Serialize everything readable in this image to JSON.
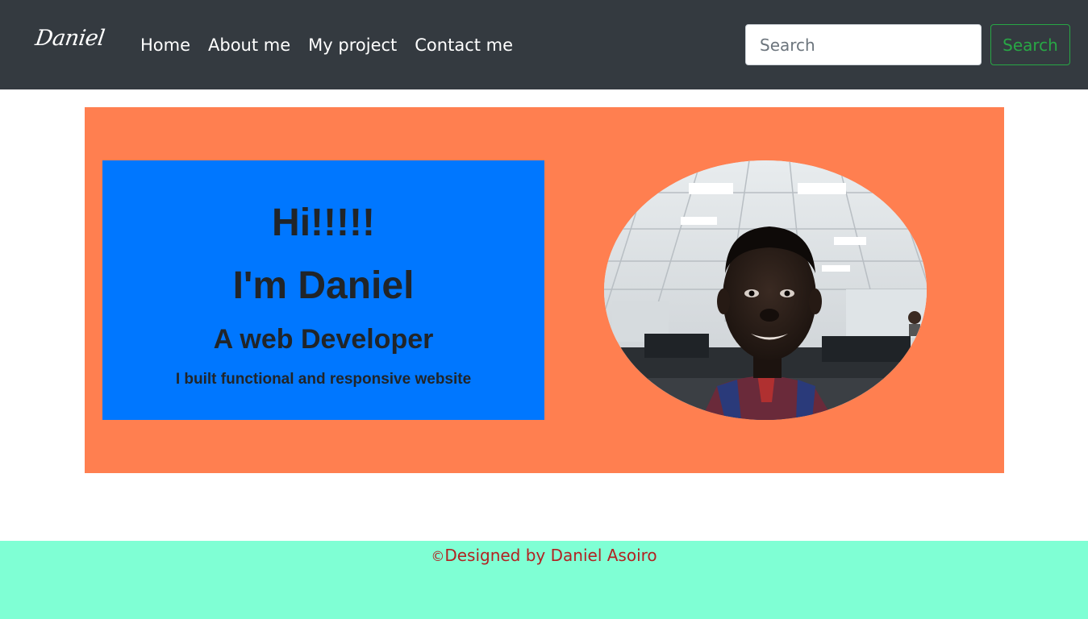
{
  "navbar": {
    "brand": "Daniel",
    "links": [
      "Home",
      "About me",
      "My project",
      "Contact me"
    ],
    "search": {
      "placeholder": "Search",
      "value": "",
      "button_label": "Search"
    }
  },
  "hero": {
    "greeting": "Hi!!!!!",
    "name_heading": "I'm Daniel",
    "role_heading": "A web Developer",
    "tagline": "I built functional and responsive website",
    "photo_icon": "profile-photo"
  },
  "footer": {
    "copyright_symbol": "©",
    "text": "Designed by Daniel Asoiro"
  },
  "colors": {
    "navbar_bg": "#343a40",
    "hero_bg": "#ff7f50",
    "card_bg": "#0077ff",
    "footer_bg": "#7fffd4",
    "footer_text": "#b22222",
    "search_button": "#28a745"
  }
}
